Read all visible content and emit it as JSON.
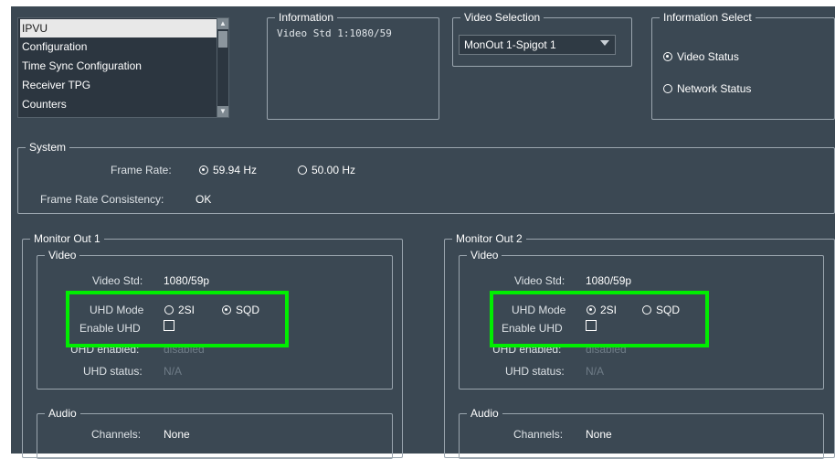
{
  "nav_list": {
    "items": [
      "IPVU",
      "Configuration",
      "Time Sync Configuration",
      "Receiver TPG",
      "Counters"
    ],
    "selected": "IPVU"
  },
  "information": {
    "title": "Information",
    "text": "Video Std 1:1080/59"
  },
  "video_selection": {
    "title": "Video Selection",
    "selected_value": "MonOut 1-Spigot 1"
  },
  "information_select": {
    "title": "Information Select",
    "options": [
      "Video Status",
      "Network Status"
    ],
    "selected": "Video Status"
  },
  "system": {
    "title": "System",
    "frame_rate_label": "Frame Rate:",
    "frame_rate_options": [
      "59.94 Hz",
      "50.00 Hz"
    ],
    "frame_rate_selected": "59.94 Hz",
    "consistency_label": "Frame Rate Consistency:",
    "consistency_value": "OK"
  },
  "monitor_out_1": {
    "title": "Monitor Out 1",
    "video_title": "Video",
    "video_std_label": "Video Std:",
    "video_std_value": "1080/59p",
    "uhd_mode_label": "UHD Mode",
    "uhd_mode_options": [
      "2SI",
      "SQD"
    ],
    "uhd_mode_selected": "SQD",
    "enable_uhd_label": "Enable UHD",
    "enable_uhd_checked": false,
    "uhd_enabled_label": "UHD enabled:",
    "uhd_enabled_value": "disabled",
    "uhd_status_label": "UHD status:",
    "uhd_status_value": "N/A",
    "audio_title": "Audio",
    "channels_label": "Channels:",
    "channels_value": "None"
  },
  "monitor_out_2": {
    "title": "Monitor Out 2",
    "video_title": "Video",
    "video_std_label": "Video Std:",
    "video_std_value": "1080/59p",
    "uhd_mode_label": "UHD Mode",
    "uhd_mode_options": [
      "2SI",
      "SQD"
    ],
    "uhd_mode_selected": "2SI",
    "enable_uhd_label": "Enable UHD",
    "enable_uhd_checked": false,
    "uhd_enabled_label": "UHD enabled:",
    "uhd_enabled_value": "disabled",
    "uhd_status_label": "UHD status:",
    "uhd_status_value": "N/A",
    "audio_title": "Audio",
    "channels_label": "Channels:",
    "channels_value": "None"
  },
  "colors": {
    "background": "#3b4853",
    "highlight": "#00ee00",
    "list_selected": "#e8e8e8",
    "disabled_text": "#6f7c87"
  }
}
